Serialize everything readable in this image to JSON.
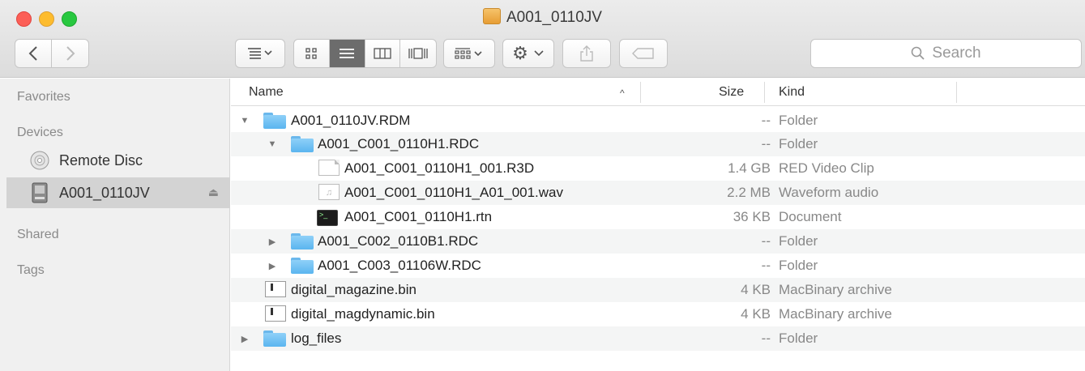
{
  "window": {
    "title": "A001_0110JV"
  },
  "toolbar": {
    "search_placeholder": "Search"
  },
  "sidebar": {
    "favorites_label": "Favorites",
    "devices_label": "Devices",
    "shared_label": "Shared",
    "tags_label": "Tags",
    "devices": [
      {
        "label": "Remote Disc",
        "icon": "disc-icon",
        "selected": false
      },
      {
        "label": "A001_0110JV",
        "icon": "drive-icon",
        "selected": true
      }
    ]
  },
  "columns": {
    "name": "Name",
    "size": "Size",
    "kind": "Kind"
  },
  "files": [
    {
      "name": "A001_0110JV.RDM",
      "size": "--",
      "kind": "Folder",
      "icon": "folder-icon",
      "expanded": true,
      "level": 0,
      "disclosure": true
    },
    {
      "name": "A001_C001_0110H1.RDC",
      "size": "--",
      "kind": "Folder",
      "icon": "folder-icon",
      "expanded": true,
      "level": 1,
      "disclosure": true
    },
    {
      "name": "A001_C001_0110H1_001.R3D",
      "size": "1.4 GB",
      "kind": "RED Video Clip",
      "icon": "document-icon",
      "level": 2,
      "disclosure": false
    },
    {
      "name": "A001_C001_0110H1_A01_001.wav",
      "size": "2.2 MB",
      "kind": "Waveform audio",
      "icon": "audio-file-icon",
      "level": 2,
      "disclosure": false
    },
    {
      "name": "A001_C001_0110H1.rtn",
      "size": "36 KB",
      "kind": "Document",
      "icon": "terminal-document-icon",
      "level": 2,
      "disclosure": false
    },
    {
      "name": "A001_C002_0110B1.RDC",
      "size": "--",
      "kind": "Folder",
      "icon": "folder-icon",
      "expanded": false,
      "level": 1,
      "disclosure": true
    },
    {
      "name": "A001_C003_01106W.RDC",
      "size": "--",
      "kind": "Folder",
      "icon": "folder-icon",
      "expanded": false,
      "level": 1,
      "disclosure": true
    },
    {
      "name": "digital_magazine.bin",
      "size": "4 KB",
      "kind": "MacBinary archive",
      "icon": "binary-file-icon",
      "level": 0,
      "disclosure": false
    },
    {
      "name": "digital_magdynamic.bin",
      "size": "4 KB",
      "kind": "MacBinary archive",
      "icon": "binary-file-icon",
      "level": 0,
      "disclosure": false
    },
    {
      "name": "log_files",
      "size": "--",
      "kind": "Folder",
      "icon": "folder-icon",
      "expanded": false,
      "level": 0,
      "disclosure": true
    }
  ]
}
